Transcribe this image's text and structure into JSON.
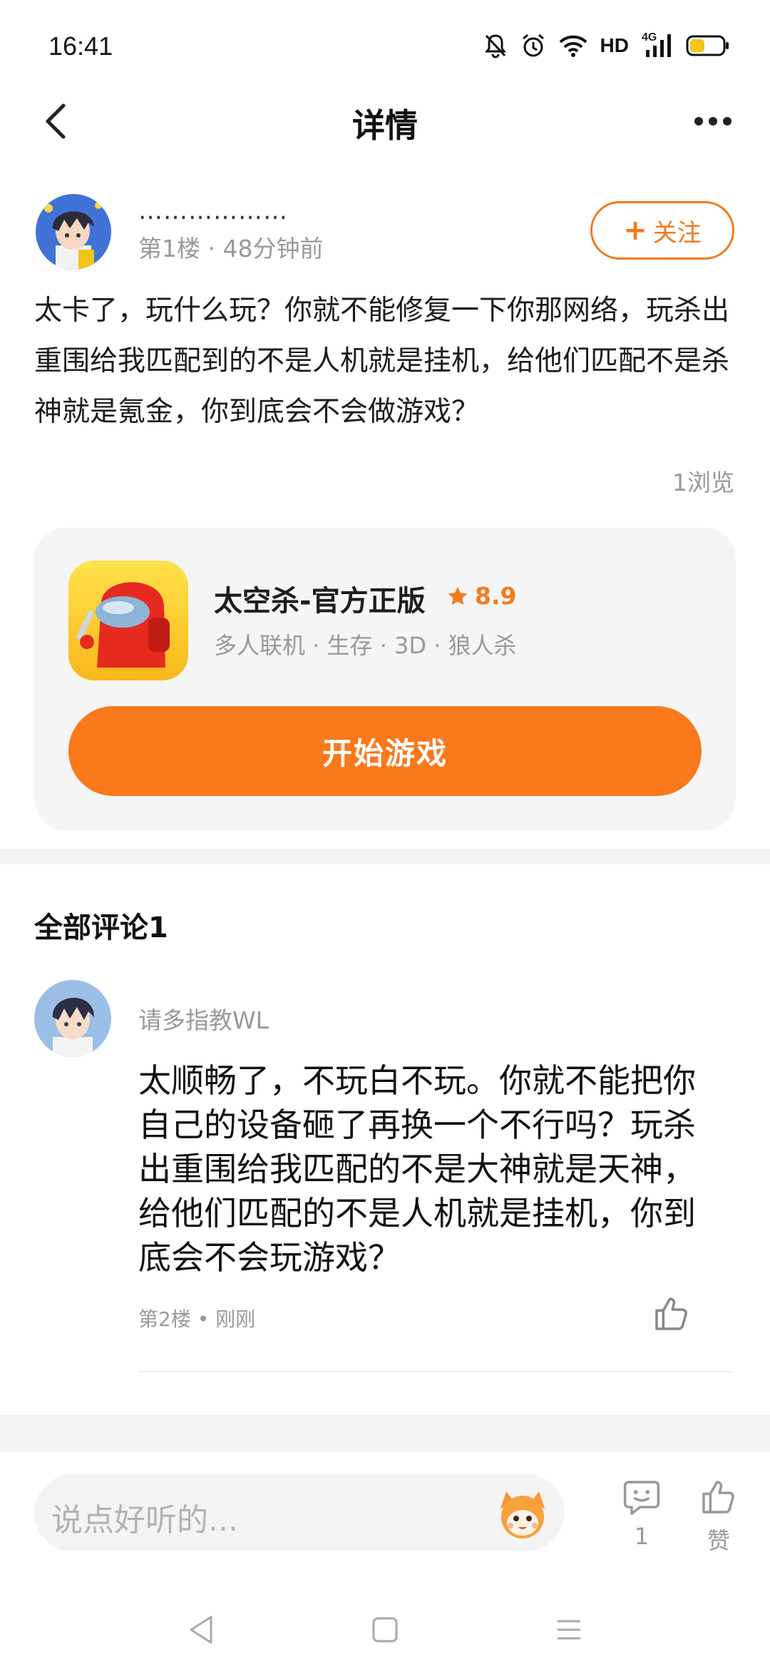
{
  "status_bar": {
    "time": "16:41",
    "network_label": "HD",
    "signal_label": "4G",
    "icons": [
      "bell-muted-icon",
      "alarm-icon",
      "wifi-icon",
      "signal-icon",
      "battery-icon"
    ],
    "battery_color": "#f5c518"
  },
  "nav": {
    "title": "详情",
    "icons": [
      "back-arrow-icon",
      "more-icon"
    ]
  },
  "post": {
    "author_name": "………………",
    "meta": "第1楼 · 48分钟前",
    "follow_label": "关注",
    "body": "太卡了，玩什么玩？你就不能修复一下你那网络，玩杀出重围给我匹配到的不是人机就是挂机，给他们匹配不是杀神就是氪金，你到底会不会做游戏？",
    "views": "1浏览"
  },
  "game_card": {
    "name": "太空杀-官方正版",
    "rating": "8.9",
    "tags": "多人联机 · 生存 · 3D · 狼人杀",
    "play_label": "开始游戏",
    "icon": "game-icon",
    "accent": "#f9791b"
  },
  "comments": {
    "header": "全部评论1",
    "items": [
      {
        "user": "请多指教WL",
        "body": "太顺畅了，不玩白不玩。你就不能把你自己的设备砸了再换一个不行吗？玩杀出重围给我匹配的不是大神就是天神，给他们匹配的不是人机就是挂机，你到底会不会玩游戏？",
        "meta": "第2楼 • 刚刚"
      }
    ]
  },
  "bottom_bar": {
    "input_placeholder": "说点好听的...",
    "comment_count": "1",
    "like_label": "赞"
  },
  "system_nav": {
    "icons": [
      "back-triangle-icon",
      "home-square-icon",
      "menu-lines-icon"
    ]
  }
}
